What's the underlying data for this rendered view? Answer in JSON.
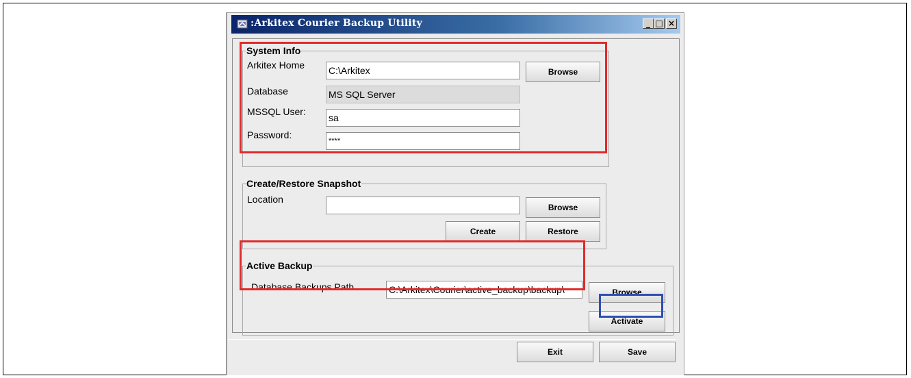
{
  "window": {
    "title": ":Arkitex Courier Backup Utility",
    "controls": {
      "minimize": "_",
      "maximize": "□",
      "close": "×"
    }
  },
  "system_info": {
    "legend": "System Info",
    "arkitex_home_label": "Arkitex Home",
    "arkitex_home_value": "C:\\Arkitex",
    "database_label": "Database",
    "database_value": "MS SQL Server",
    "mssql_user_label": "MSSQL User:",
    "mssql_user_value": "sa",
    "password_label": "Password:",
    "password_value": "****",
    "browse_label": "Browse"
  },
  "snapshot": {
    "legend": "Create/Restore Snapshot",
    "location_label": "Location",
    "location_value": "",
    "browse_label": "Browse",
    "create_label": "Create",
    "restore_label": "Restore"
  },
  "active_backup": {
    "legend": "Active Backup",
    "path_label": "Database Backups Path",
    "path_value": "C:\\Arkitex\\Courier\\active_backup\\backup\\",
    "browse_label": "Browse",
    "activate_label": "Activate"
  },
  "footer": {
    "exit_label": "Exit",
    "save_label": "Save"
  },
  "colors": {
    "highlight_red": "#e12a2a",
    "highlight_blue": "#2c4fb5",
    "titlebar": "#0a246a"
  },
  "icons": {
    "app": "app-window-icon"
  }
}
